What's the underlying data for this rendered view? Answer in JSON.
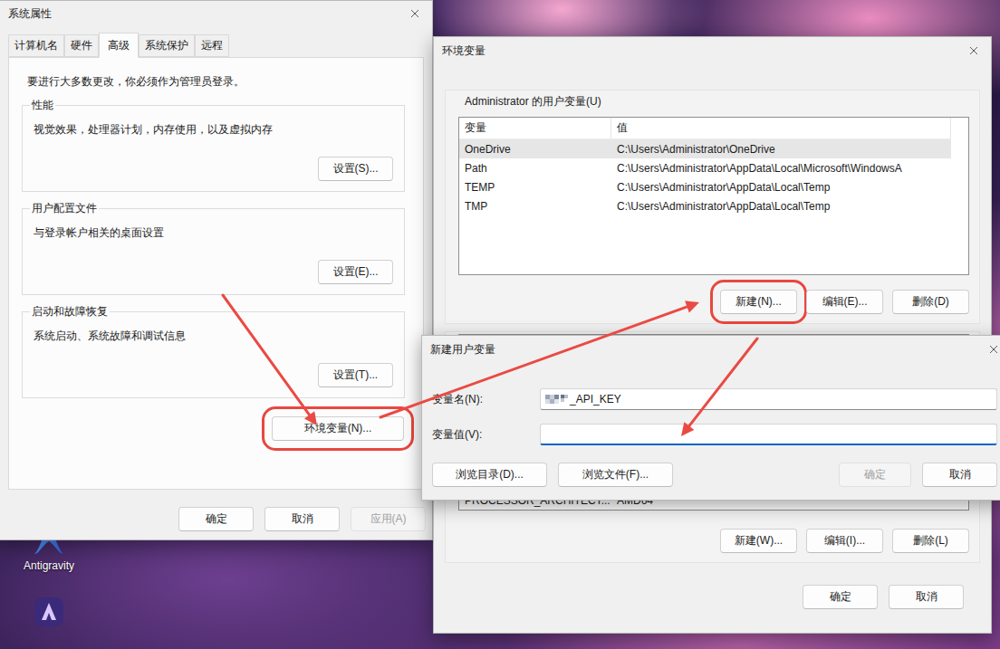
{
  "system_properties": {
    "title": "系统属性",
    "tabs": [
      {
        "label": "计算机名",
        "selected": false
      },
      {
        "label": "硬件",
        "selected": false
      },
      {
        "label": "高级",
        "selected": true
      },
      {
        "label": "系统保护",
        "selected": false
      },
      {
        "label": "远程",
        "selected": false
      }
    ],
    "notice": "要进行大多数更改，你必须作为管理员登录。",
    "groups": [
      {
        "title": "性能",
        "description": "视觉效果，处理器计划，内存使用，以及虚拟内存",
        "button": {
          "label": "设置(S)...",
          "highlighted": false
        }
      },
      {
        "title": "用户配置文件",
        "description": "与登录帐户相关的桌面设置",
        "button": {
          "label": "设置(E)...",
          "highlighted": false
        }
      },
      {
        "title": "启动和故障恢复",
        "description": "系统启动、系统故障和调试信息",
        "button": {
          "label": "设置(T)...",
          "highlighted": false
        }
      }
    ],
    "env_button": {
      "label": "环境变量(N)...",
      "highlighted": true
    },
    "buttons": [
      {
        "label": "确定",
        "disabled": false
      },
      {
        "label": "取消",
        "disabled": false
      },
      {
        "label": "应用(A)",
        "disabled": true
      }
    ]
  },
  "environment_variables": {
    "title": "环境变量",
    "user_group": "Administrator 的用户变量(U)",
    "columns": [
      "变量",
      "值"
    ],
    "user_rows": [
      {
        "name": "OneDrive",
        "value": "C:\\Users\\Administrator\\OneDrive",
        "selected": true
      },
      {
        "name": "Path",
        "value": "C:\\Users\\Administrator\\AppData\\Local\\Microsoft\\WindowsA",
        "selected": false
      },
      {
        "name": "TEMP",
        "value": "C:\\Users\\Administrator\\AppData\\Local\\Temp",
        "selected": false
      },
      {
        "name": "TMP",
        "value": "C:\\Users\\Administrator\\AppData\\Local\\Temp",
        "selected": false
      }
    ],
    "user_buttons": [
      {
        "label": "新建(N)...",
        "highlighted": true
      },
      {
        "label": "编辑(E)...",
        "highlighted": false
      },
      {
        "label": "删除(D)",
        "highlighted": false
      }
    ],
    "system_rows": [
      {
        "name": "PROCESSOR_ARCHITECT...",
        "value": "AMD64",
        "selected": false
      }
    ],
    "system_buttons": [
      {
        "label": "新建(W)...",
        "highlighted": false
      },
      {
        "label": "编辑(I)...",
        "highlighted": false
      },
      {
        "label": "删除(L)",
        "highlighted": false
      }
    ],
    "buttons": [
      {
        "label": "确定",
        "disabled": false
      },
      {
        "label": "取消",
        "disabled": false
      }
    ]
  },
  "new_variable_dialog": {
    "title": "新建用户变量",
    "fields": [
      {
        "label": "变量名(N):",
        "value": "_API_KEY",
        "redacted": true,
        "focused": false
      },
      {
        "label": "变量值(V):",
        "value": "",
        "redacted": false,
        "focused": true
      }
    ],
    "browse_buttons": [
      {
        "label": "浏览目录(D)..."
      },
      {
        "label": "浏览文件(F)..."
      }
    ],
    "buttons": [
      {
        "label": "确定",
        "disabled": true
      },
      {
        "label": "取消",
        "disabled": false
      }
    ]
  },
  "desktop_icons": [
    {
      "label": "Antigravity",
      "kind": "antigravity"
    },
    {
      "label": "",
      "kind": "app"
    }
  ]
}
